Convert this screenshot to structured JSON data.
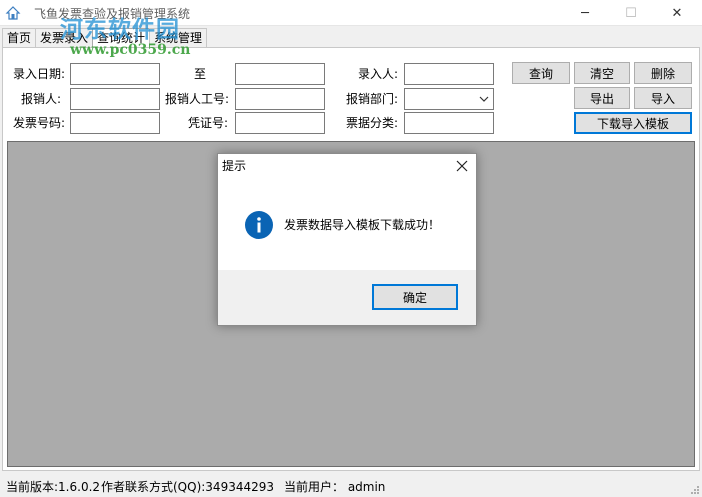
{
  "window": {
    "title": "飞鱼发票查验及报销管理系统",
    "minimize_glyph": "─",
    "maximize_glyph": "☐",
    "close_glyph": "✕",
    "icon": "app-house-icon"
  },
  "watermark": {
    "line1": "河东软件园",
    "line2": "www.pc0359.cn"
  },
  "tabs": [
    {
      "label": "首页",
      "active": false
    },
    {
      "label": "发票录入",
      "active": false
    },
    {
      "label": "查询统计",
      "active": true
    },
    {
      "label": "系统管理",
      "active": false
    }
  ],
  "form": {
    "entry_date_label": "录入日期:",
    "entry_date_from": "",
    "to_label": "至",
    "entry_date_to": "",
    "entered_by_label": "录入人:",
    "entered_by": "",
    "claimant_label": "报销人:",
    "claimant": "",
    "claimant_id_label": "报销人工号:",
    "claimant_id": "",
    "department_label": "报销部门:",
    "department": "",
    "invoice_no_label": "发票号码:",
    "invoice_no": "",
    "voucher_no_label": "凭证号:",
    "voucher_no": "",
    "doc_category_label": "票据分类:",
    "doc_category": ""
  },
  "buttons": {
    "query": "查询",
    "clear": "清空",
    "delete": "删除",
    "export": "导出",
    "import": "导入",
    "download_template": "下载导入模板"
  },
  "status": {
    "version": "当前版本:1.6.0.2",
    "contact": "作者联系方式(QQ):349344293",
    "user": "当前用户：  admin"
  },
  "dialog": {
    "title": "提示",
    "message": "发票数据导入模板下载成功！",
    "ok": "确定",
    "close_glyph": "✕"
  },
  "colors": {
    "accent": "#0078d7",
    "info_icon": "#0a64b4",
    "grid_bg": "#ababab"
  }
}
